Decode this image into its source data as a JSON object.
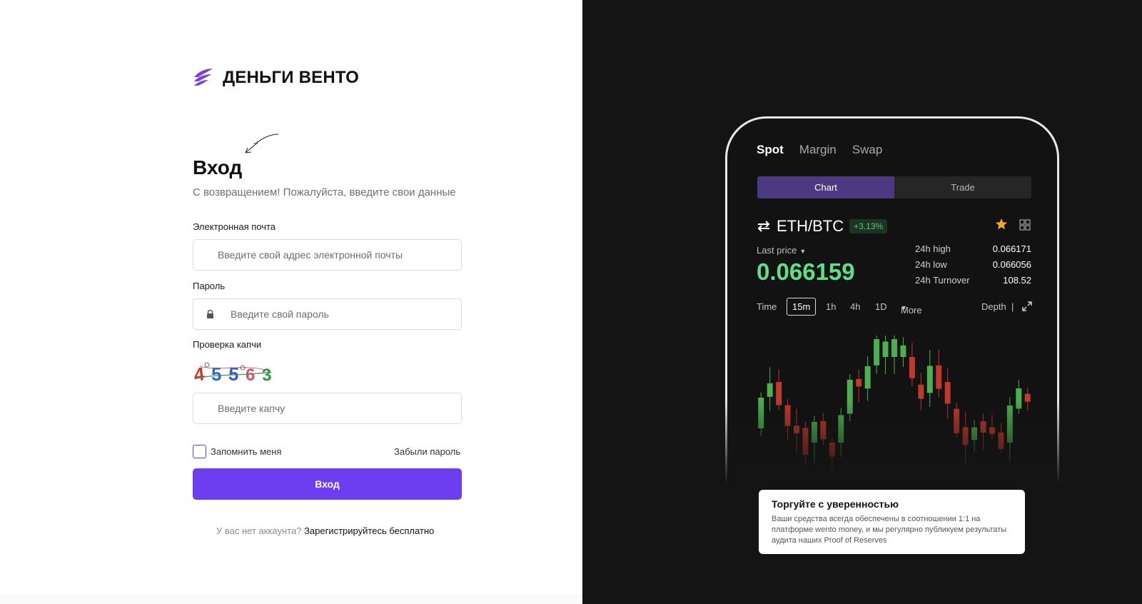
{
  "brand": {
    "name": "ДЕНЬГИ ВЕНТО"
  },
  "login": {
    "title": "Вход",
    "subtitle": "С возвращением! Пожалуйста, введите свои данные",
    "email_label": "Электронная почта",
    "email_placeholder": "Введите свой адрес электронной почты",
    "password_label": "Пароль",
    "password_placeholder": "Введите свой пароль",
    "captcha_label": "Проверка капчи",
    "captcha_code": "45563",
    "captcha_placeholder": "Введите капчу",
    "remember_label": "Запомнить меня",
    "forgot_label": "Забыли пароль",
    "submit_label": "Вход",
    "signup_question": "У вас нет аккаунта?",
    "signup_link": "Зарегистрируйтесь бесплатно"
  },
  "phone": {
    "tabs": [
      "Spot",
      "Margin",
      "Swap"
    ],
    "segments": [
      "Chart",
      "Trade"
    ],
    "pair": "ETH/BTC",
    "change": "+3.13%",
    "last_price_label": "Last price",
    "last_price": "0.066159",
    "stats": [
      {
        "label": "24h high",
        "value": "0.066171"
      },
      {
        "label": "24h low",
        "value": "0.066056"
      },
      {
        "label": "24h Turnover",
        "value": "108.52"
      }
    ],
    "timebar": {
      "time": "Time",
      "selected": "15m",
      "options": [
        "1h",
        "4h",
        "1D"
      ],
      "more": "More",
      "depth": "Depth",
      "sep": "|"
    }
  },
  "promo": {
    "title": "Торгуйте с уверенностью",
    "text": "Ваши средства всегда обеспечены в соотношении 1:1 на платформе wento money, и мы регулярно публикуем результаты аудита наших Proof of Reserves"
  },
  "colors": {
    "accent": "#6c3ef0",
    "up": "#4caf50",
    "down": "#c0392b",
    "dark_bg": "#141414"
  }
}
